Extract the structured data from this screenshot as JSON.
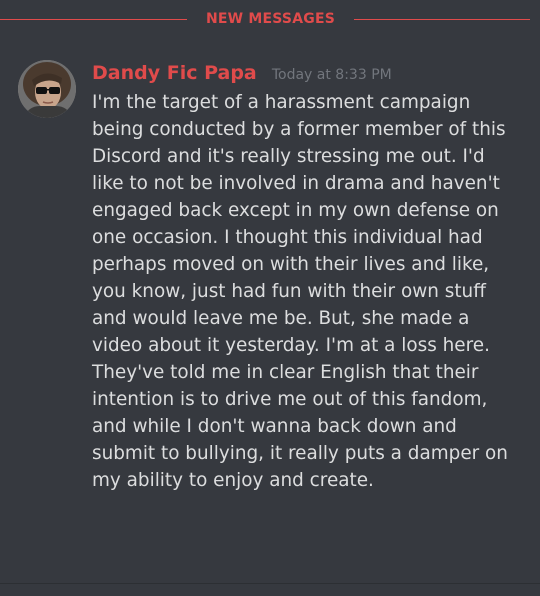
{
  "divider": {
    "label": "NEW MESSAGES",
    "color": "#e04b4b"
  },
  "message": {
    "author": "Dandy Fic Papa",
    "author_color": "#e04b4b",
    "timestamp": "Today at 8:33 PM",
    "avatar": "user-avatar-sunglasses",
    "content": "I'm the target of a harassment campaign\nbeing conducted by a former member of this\nDiscord and it's really stressing me out. I'd\nlike to not be involved in drama and haven't\nengaged back except in my own defense on\none occasion. I thought this individual had\nperhaps moved on with their lives and like,\nyou know, just had fun with their own stuff\nand would leave me be. But, she made a\nvideo about it yesterday. I'm at a loss here.\nThey've told me in clear English that their\nintention is to drive me out of this fandom,\nand while I don't wanna back down and\nsubmit to bullying, it really puts a damper on\nmy ability to enjoy and create."
  },
  "theme": {
    "background": "#36393f",
    "text": "#dcddde",
    "timestamp": "#72767d"
  }
}
